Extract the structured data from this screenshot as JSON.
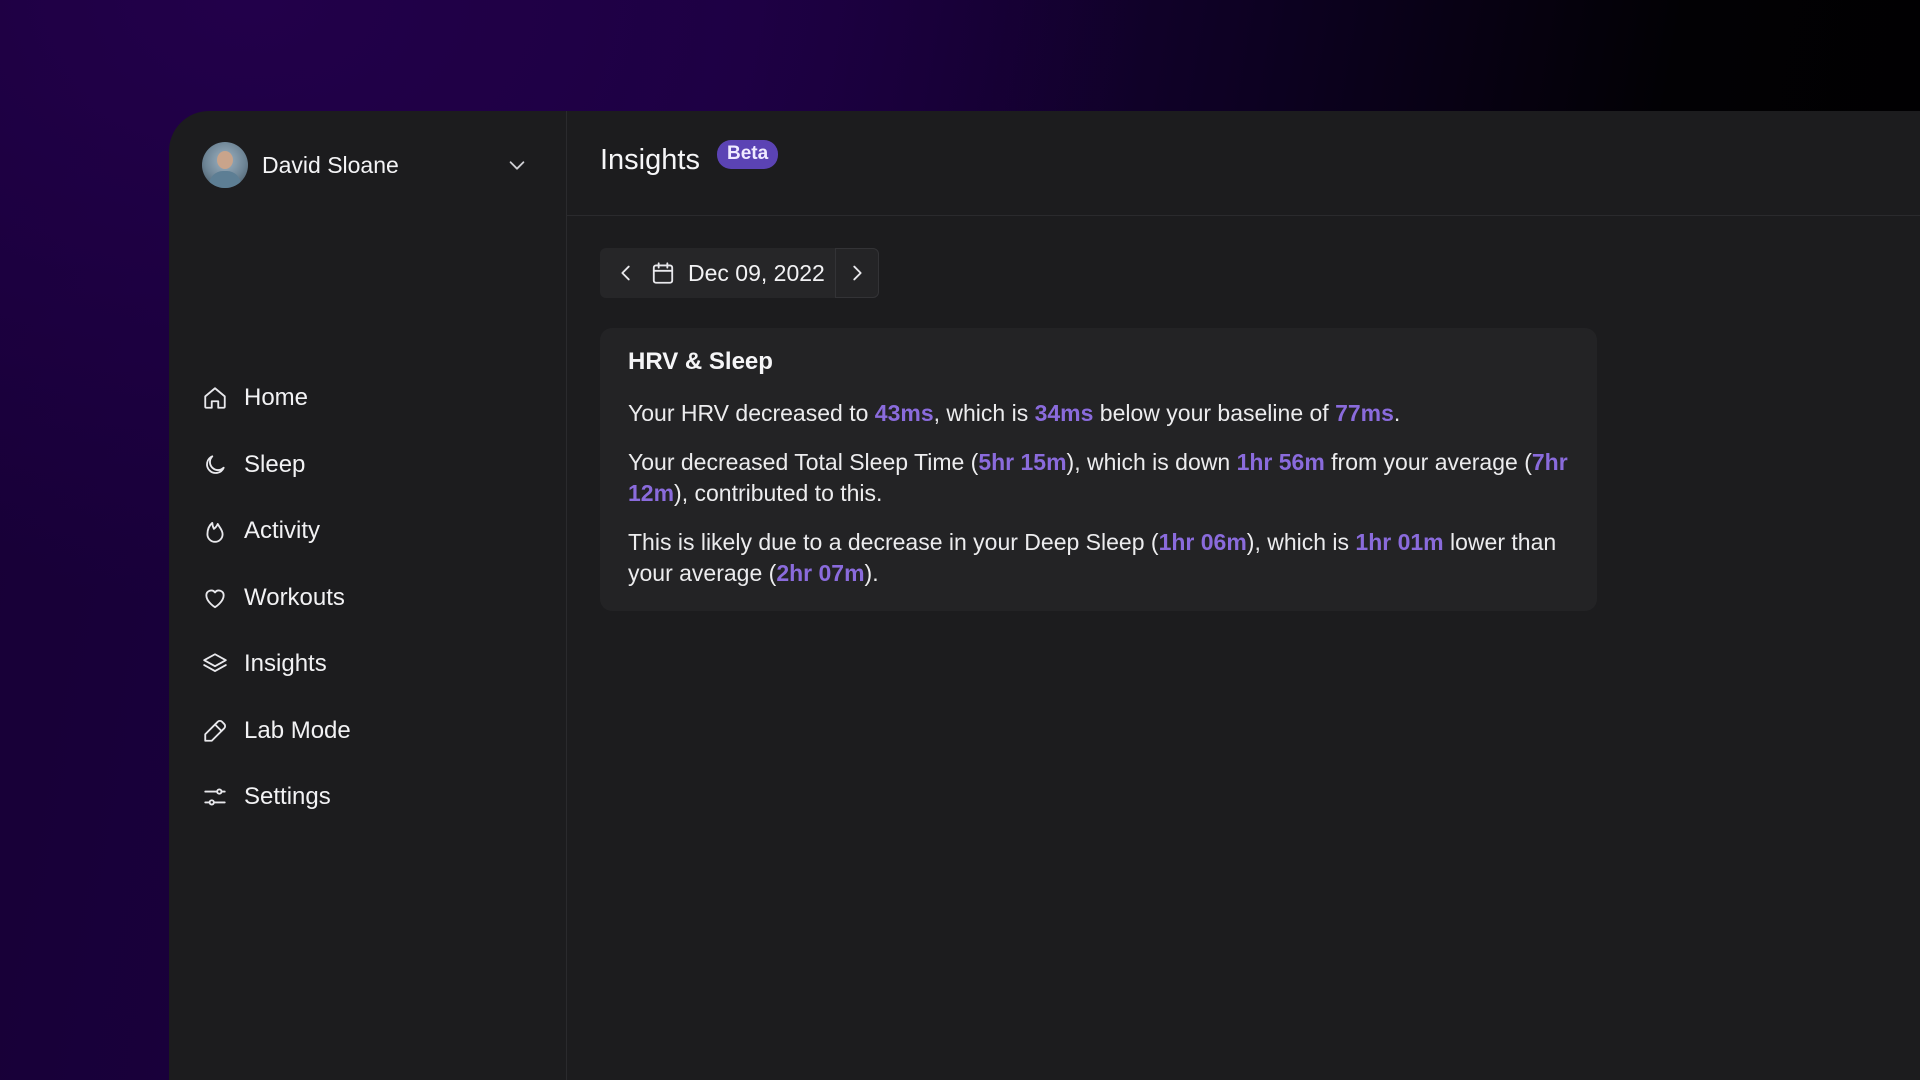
{
  "user": {
    "name": "David Sloane"
  },
  "nav": [
    {
      "label": "Home",
      "icon": "home-icon"
    },
    {
      "label": "Sleep",
      "icon": "moon-icon"
    },
    {
      "label": "Activity",
      "icon": "flame-icon"
    },
    {
      "label": "Workouts",
      "icon": "heart-icon"
    },
    {
      "label": "Insights",
      "icon": "layers-icon"
    },
    {
      "label": "Lab Mode",
      "icon": "pipette-icon"
    },
    {
      "label": "Settings",
      "icon": "sliders-icon"
    }
  ],
  "header": {
    "title": "Insights",
    "badge": "Beta"
  },
  "date_nav": {
    "date": "Dec 09, 2022"
  },
  "card": {
    "title": "HRV & Sleep",
    "p1": {
      "t1": "Your HRV decreased to ",
      "v1": "43ms",
      "t2": ", which is ",
      "v2": "34ms",
      "t3": " below your baseline of ",
      "v3": "77ms",
      "t4": "."
    },
    "p2": {
      "t1": "Your decreased Total Sleep Time (",
      "v1": "5hr 15m",
      "t2": "), which is down ",
      "v2": "1hr 56m",
      "t3": " from your average (",
      "v3": "7hr 12m",
      "t4": "), contributed to this."
    },
    "p3": {
      "t1": "This is likely due to a decrease in your Deep Sleep (",
      "v1": "1hr 06m",
      "t2": "), which is ",
      "v2": "1hr 01m",
      "t3": " lower than your average (",
      "v3": "2hr 07m",
      "t4": ")."
    }
  },
  "colors": {
    "accent": "#8a6bdc",
    "badge": "#5b43b4",
    "panel": "#1c1c1e",
    "card": "#232325"
  }
}
